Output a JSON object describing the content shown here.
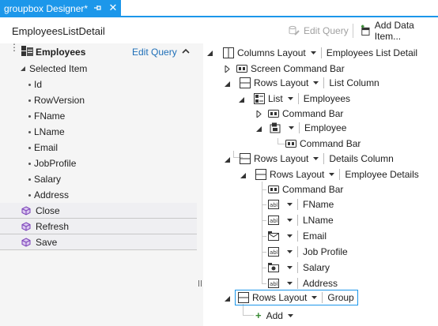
{
  "tab": {
    "title": "groupbox Designer*"
  },
  "toolbar": {
    "screen_name": "EmployeesListDetail",
    "edit_query": "Edit Query",
    "add_data_item": "Add Data Item..."
  },
  "left_panel": {
    "entity": "Employees",
    "edit_query": "Edit Query",
    "selected_item": "Selected Item",
    "properties": [
      "Id",
      "RowVersion",
      "FName",
      "LName",
      "Email",
      "JobProfile",
      "Salary",
      "Address"
    ],
    "commands": [
      "Close",
      "Refresh",
      "Save"
    ]
  },
  "tree": {
    "root": {
      "control": "Columns Layout",
      "name": "Employees List Detail"
    },
    "screen_command_bar": "Screen Command Bar",
    "list_column": {
      "control": "Rows Layout",
      "name": "List Column"
    },
    "list": {
      "control": "List",
      "name": "Employees"
    },
    "list_command_bar": "Command Bar",
    "employee": {
      "name": "Employee"
    },
    "employee_command_bar": "Command Bar",
    "details_column": {
      "control": "Rows Layout",
      "name": "Details Column"
    },
    "employee_details": {
      "control": "Rows Layout",
      "name": "Employee Details"
    },
    "details_command_bar": "Command Bar",
    "fields": [
      "FName",
      "LName",
      "Email",
      "Job Profile",
      "Salary",
      "Address"
    ],
    "group": {
      "control": "Rows Layout",
      "name": "Group"
    },
    "add": "Add"
  },
  "colors": {
    "accent": "#1c97ea",
    "panel_bg": "#f5f5f5",
    "link": "#1e6fb8"
  }
}
